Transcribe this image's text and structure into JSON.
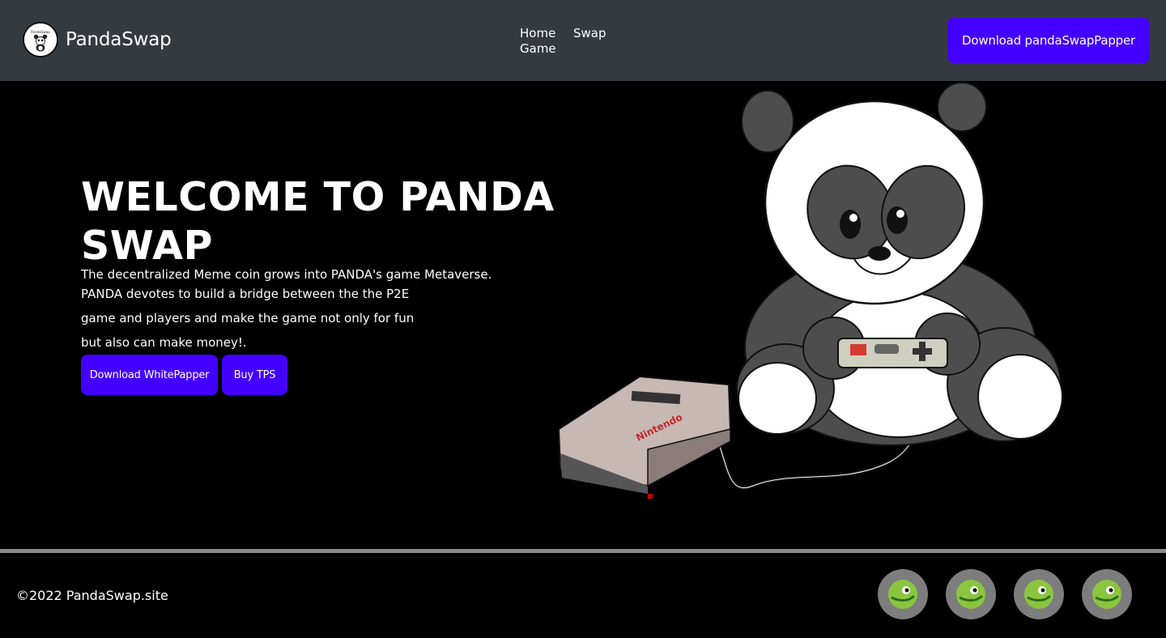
{
  "navbar": {
    "brand": {
      "name": "PandaSwap",
      "logo_text": "PandaSwap",
      "logo_icon": "panda-logo-icon"
    },
    "links": [
      {
        "label": "Home"
      },
      {
        "label": "Swap"
      },
      {
        "label": "Game"
      }
    ],
    "download_button": "Download pandaSwapPapper"
  },
  "hero": {
    "title": "WELCOME TO PANDA SWAP",
    "lines": [
      "The decentralized Meme coin grows into PANDA's game Metaverse.",
      "PANDA devotes to build a bridge between the the P2E",
      "game and players and make the game not only for fun",
      "but also can make money!."
    ],
    "buttons": {
      "whitepaper": "Download WhitePapper",
      "buy": "Buy TPS"
    },
    "illustration": {
      "console_label": "Nintendo"
    }
  },
  "footer": {
    "copyright": "©2022 PandaSwap.site",
    "socials": [
      {
        "icon": "coingecko-icon"
      },
      {
        "icon": "coingecko-icon"
      },
      {
        "icon": "coingecko-icon"
      },
      {
        "icon": "coingecko-icon"
      }
    ]
  },
  "colors": {
    "navbar_bg": "#343a40",
    "accent": "#4400ff",
    "page_bg": "#000000",
    "divider": "#8a8a8a",
    "social_bg": "#7d7d7d",
    "gecko_green": "#8bc53f"
  }
}
